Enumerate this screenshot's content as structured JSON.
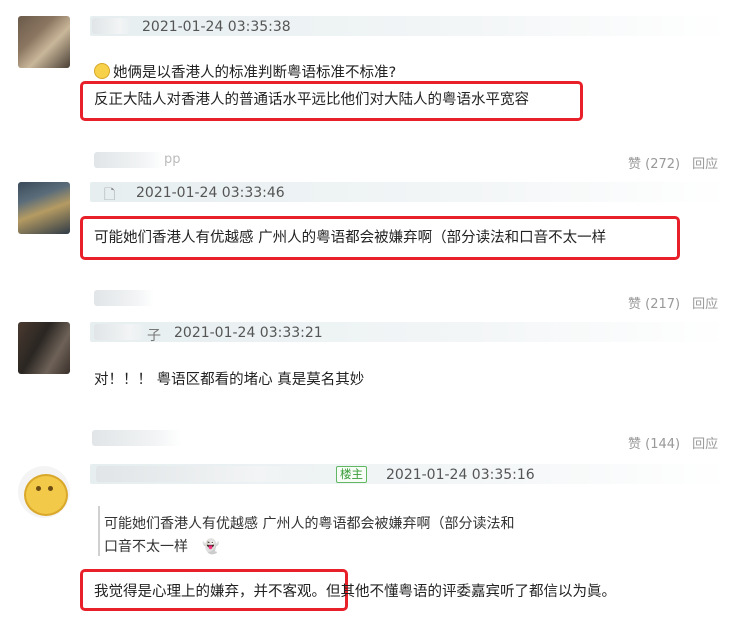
{
  "comments": [
    {
      "timestamp": "2021-01-24 03:35:38",
      "lines": [
        "她俩是以香港人的标准判断粤语标准不标准?",
        "反正大陆人对香港人的普通话水平远比他们对大陆人的粤语水平宽容"
      ],
      "user_suffix": "pp",
      "likes": "赞 (272)",
      "reply": "回应"
    },
    {
      "timestamp": "2021-01-24 03:33:46",
      "lines": [
        "可能她们香港人有优越感 广州人的粤语都会被嫌弃啊（部分读法和口音不太一样"
      ],
      "likes": "赞 (217)",
      "reply": "回应"
    },
    {
      "timestamp": "2021-01-24 03:33:21",
      "user_suffix": "子",
      "lines": [
        "对！！！ 粤语区都看的堵心 真是莫名其妙"
      ],
      "likes": "赞 (144)",
      "reply": "回应"
    },
    {
      "timestamp": "2021-01-24 03:35:16",
      "op_badge": "楼主",
      "quote": [
        "可能她们香港人有优越感 广州人的粤语都会被嫌弃啊（部分读法和",
        "口音不太一样"
      ],
      "reply_highlight": "我觉得是心理上的嫌弃，并不客观。",
      "reply_rest": "但其他不懂粤语的评委嘉宾听了都信以为眞。"
    }
  ],
  "colors": {
    "highlight_border": "#e8202a",
    "op_badge": "#3a9d3a",
    "meta_text": "#999999"
  }
}
